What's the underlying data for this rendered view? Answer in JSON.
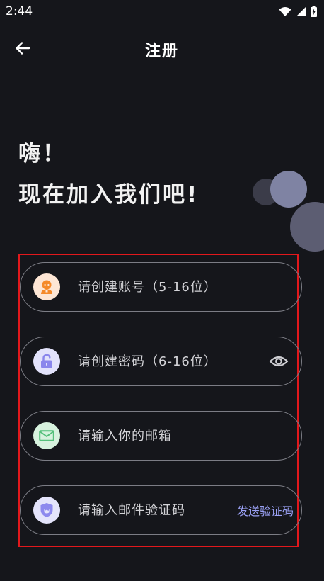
{
  "status_bar": {
    "time": "2:44"
  },
  "app_bar": {
    "title": "注册"
  },
  "greeting": {
    "line1": "嗨！",
    "line2": "现在加入我们吧!"
  },
  "form": {
    "account": {
      "placeholder": "请创建账号（5-16位）",
      "value": ""
    },
    "password": {
      "placeholder": "请创建密码（6-16位）",
      "value": ""
    },
    "email": {
      "placeholder": "请输入你的邮箱",
      "value": ""
    },
    "code": {
      "placeholder": "请输入邮件验证码",
      "value": "",
      "send_label": "发送验证码"
    }
  },
  "icons": {
    "account": "user-icon",
    "password": "lock-icon",
    "email": "mail-icon",
    "code": "shield-icon",
    "visibility": "eye-icon"
  },
  "colors": {
    "background": "#15161b",
    "highlight_border": "#e2181c",
    "account_icon_bg": "#fde6d5",
    "account_icon": "#f58a2a",
    "password_icon_bg": "#e2e2fb",
    "password_icon": "#8a86ec",
    "email_icon_bg": "#d7f2de",
    "email_icon": "#54c07a",
    "code_icon_bg": "#e4e4fb",
    "code_icon": "#8d89ee",
    "accent_link": "#9aa1f5"
  }
}
